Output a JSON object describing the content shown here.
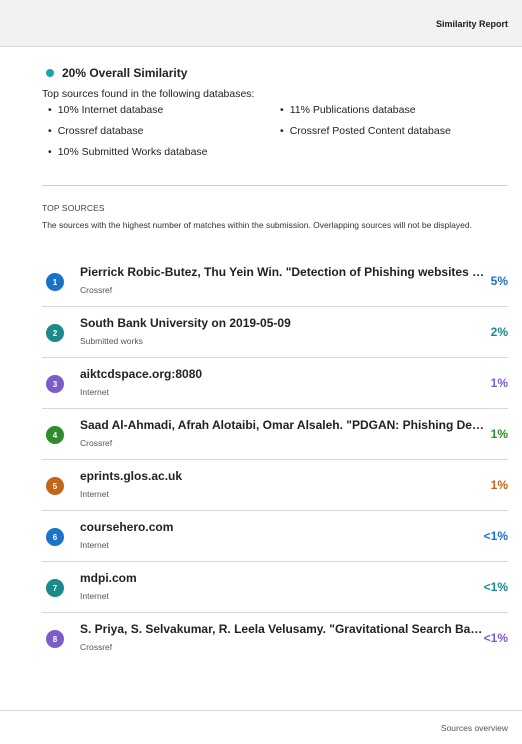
{
  "header": {
    "title": "Similarity Report"
  },
  "summary": {
    "overall": "20% Overall Similarity",
    "intro": "Top sources found in the following databases:",
    "databases": [
      "10% Internet database",
      "11% Publications database",
      "Crossref database",
      "Crossref Posted Content database",
      "10% Submitted Works database"
    ],
    "dot_color": "#1aa3b0"
  },
  "top_sources": {
    "heading": "TOP SOURCES",
    "description": "The sources with the highest number of matches within the submission. Overlapping sources will not be displayed.",
    "items": [
      {
        "number": "1",
        "title": "Pierrick Robic-Butez, Thu Yein Win. \"Detection of Phishing websites using Generative Adversarial Network\"",
        "type": "Crossref",
        "percent": "5%",
        "color": "#1a73c8"
      },
      {
        "number": "2",
        "title": "South Bank University on 2019-05-09",
        "type": "Submitted works",
        "percent": "2%",
        "color": "#1a8a8a"
      },
      {
        "number": "3",
        "title": "aiktcdspace.org:8080",
        "type": "Internet",
        "percent": "1%",
        "color": "#7b5cc8"
      },
      {
        "number": "4",
        "title": "Saad Al-Ahmadi, Afrah Alotaibi, Omar Alsaleh. \"PDGAN: Phishing Detection with Generative Adversarial Networks\"",
        "type": "Crossref",
        "percent": "1%",
        "color": "#2e8b2e"
      },
      {
        "number": "5",
        "title": "eprints.glos.ac.uk",
        "type": "Internet",
        "percent": "1%",
        "color": "#c0651a"
      },
      {
        "number": "6",
        "title": "coursehero.com",
        "type": "Internet",
        "percent": "<1%",
        "color": "#1a73c8"
      },
      {
        "number": "7",
        "title": "mdpi.com",
        "type": "Internet",
        "percent": "<1%",
        "color": "#1a8a8a"
      },
      {
        "number": "8",
        "title": "S. Priya, S. Selvakumar, R. Leela Velusamy. \"Gravitational Search Based Feature Selection\"",
        "type": "Crossref",
        "percent": "<1%",
        "color": "#7b5cc8"
      }
    ]
  },
  "footer": {
    "text": "Sources overview"
  }
}
